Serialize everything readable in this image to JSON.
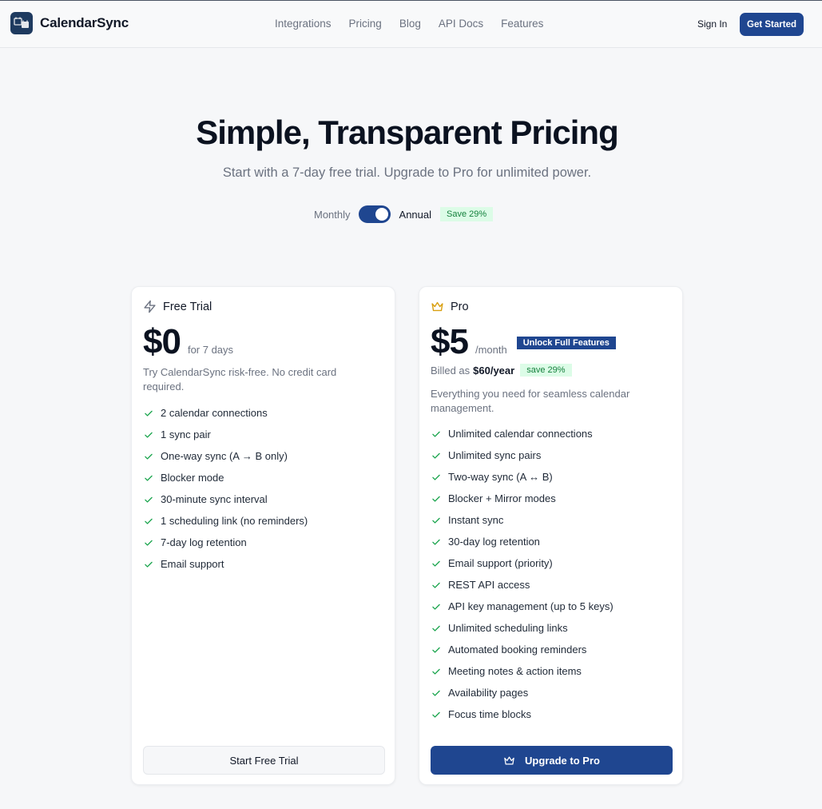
{
  "header": {
    "brand": "CalendarSync",
    "nav": [
      "Integrations",
      "Pricing",
      "Blog",
      "API Docs",
      "Features"
    ],
    "sign_in": "Sign In",
    "get_started": "Get Started"
  },
  "hero": {
    "title": "Simple, Transparent Pricing",
    "subtitle": "Start with a 7-day free trial. Upgrade to Pro for unlimited power.",
    "billing": {
      "monthly": "Monthly",
      "annual": "Annual",
      "selected": "Annual",
      "save_badge": "Save 29%"
    }
  },
  "plans": {
    "free": {
      "icon": "lightning-icon",
      "name": "Free Trial",
      "price": "$0",
      "period": "for 7 days",
      "description": "Try CalendarSync risk-free. No credit card required.",
      "features": [
        "2 calendar connections",
        "1 sync pair",
        "One-way sync (A → B only)",
        "Blocker mode",
        "30-minute sync interval",
        "1 scheduling link (no reminders)",
        "7-day log retention",
        "Email support"
      ],
      "cta": "Start Free Trial"
    },
    "pro": {
      "icon": "crown-icon",
      "name": "Pro",
      "price": "$5",
      "period": "/month",
      "badge": "Unlock Full Features",
      "billed_prefix": "Billed as",
      "billed_amount": "$60/year",
      "billed_save": "save 29%",
      "description": "Everything you need for seamless calendar management.",
      "features": [
        "Unlimited calendar connections",
        "Unlimited sync pairs",
        "Two-way sync (A ↔ B)",
        "Blocker + Mirror modes",
        "Instant sync",
        "30-day log retention",
        "Email support (priority)",
        "REST API access",
        "API key management (up to 5 keys)",
        "Unlimited scheduling links",
        "Automated booking reminders",
        "Meeting notes & action items",
        "Availability pages",
        "Focus time blocks"
      ],
      "cta": "Upgrade to Pro"
    }
  },
  "colors": {
    "primary": "#1f4690",
    "check": "#16a34a",
    "crown": "#d9a012",
    "save_bg": "#dcfce7"
  }
}
